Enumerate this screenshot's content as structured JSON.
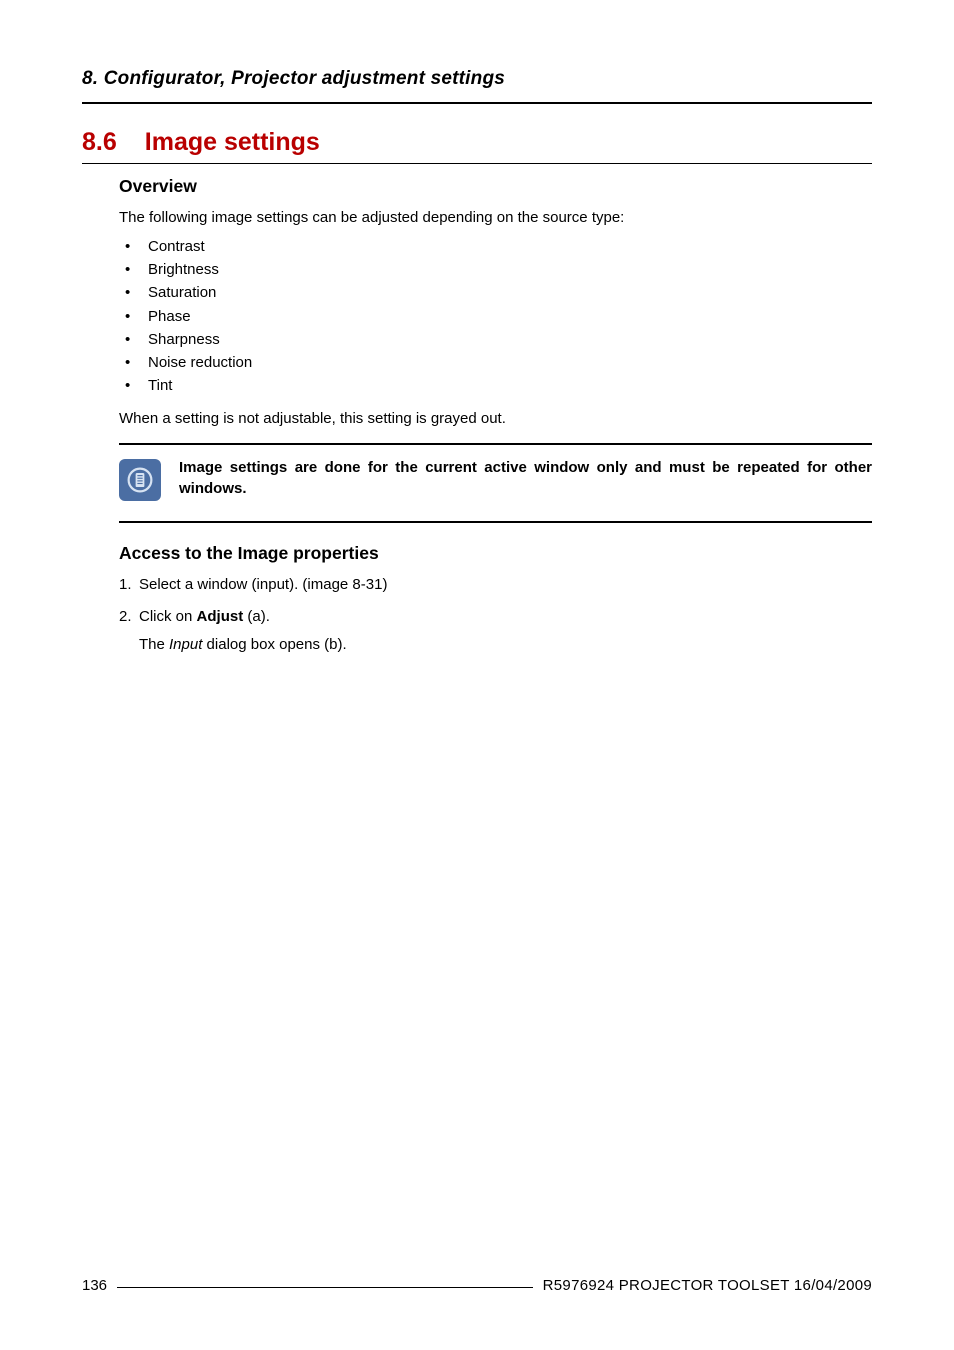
{
  "chapter": "8.  Configurator, Projector adjustment settings",
  "section": {
    "number": "8.6",
    "title": "Image settings"
  },
  "overview": {
    "heading": "Overview",
    "intro": "The following image settings can be adjusted depending on the source type:",
    "items": [
      "Contrast",
      "Brightness",
      "Saturation",
      "Phase",
      "Sharpness",
      "Noise reduction",
      "Tint"
    ],
    "after": "When a setting is not adjustable, this setting is grayed out."
  },
  "note": "Image settings are done for the current active window only and must be repeated for other windows.",
  "access": {
    "heading": "Access to the Image properties",
    "step1_pre": "Select a window (input).  (image 8-31)",
    "step2_pre": "Click on ",
    "step2_bold": "Adjust",
    "step2_post": " (a).",
    "sub_pre": "The ",
    "sub_italic": "Input",
    "sub_post": " dialog box opens (b)."
  },
  "footer": {
    "page": "136",
    "doc": "R5976924   PROJECTOR TOOLSET   16/04/2009"
  }
}
